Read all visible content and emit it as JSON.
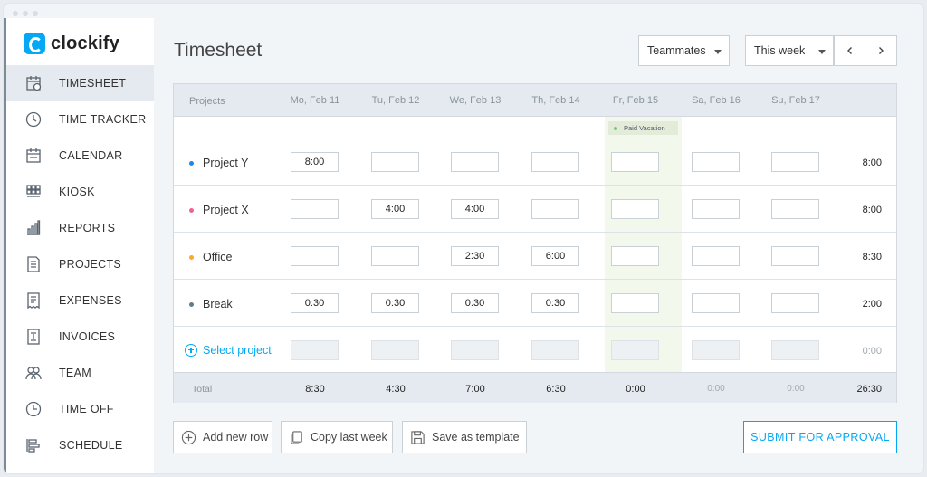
{
  "app": {
    "name": "clockify"
  },
  "sidebar": {
    "items": [
      {
        "label": "TIMESHEET",
        "icon": "timesheet-icon",
        "active": true
      },
      {
        "label": "TIME TRACKER",
        "icon": "clock-icon"
      },
      {
        "label": "CALENDAR",
        "icon": "calendar-icon"
      },
      {
        "label": "KIOSK",
        "icon": "kiosk-icon"
      },
      {
        "label": "REPORTS",
        "icon": "bar-chart-icon"
      },
      {
        "label": "PROJECTS",
        "icon": "document-icon"
      },
      {
        "label": "EXPENSES",
        "icon": "receipt-icon"
      },
      {
        "label": "INVOICES",
        "icon": "invoice-icon"
      },
      {
        "label": "TEAM",
        "icon": "team-icon"
      },
      {
        "label": "TIME OFF",
        "icon": "time-off-icon"
      },
      {
        "label": "SCHEDULE",
        "icon": "schedule-icon"
      }
    ]
  },
  "header": {
    "title": "Timesheet",
    "teammates_label": "Teammates",
    "range_label": "This week",
    "prev_icon": "chevron-left-icon",
    "next_icon": "chevron-right-icon"
  },
  "table": {
    "projects_header": "Projects",
    "days": [
      "Mo, Feb 11",
      "Tu, Feb 12",
      "We, Feb 13",
      "Th, Feb 14",
      "Fr, Feb 15",
      "Sa, Feb 16",
      "Su, Feb 17"
    ],
    "vacation_badge": "Paid Vacation",
    "rows": [
      {
        "name": "Project Y",
        "color": "#1e88e5",
        "values": [
          "8:00",
          "",
          "",
          "",
          "",
          "",
          ""
        ],
        "total": "8:00"
      },
      {
        "name": "Project X",
        "color": "#f06292",
        "values": [
          "",
          "4:00",
          "4:00",
          "",
          "",
          "",
          ""
        ],
        "total": "8:00"
      },
      {
        "name": "Office",
        "color": "#ffa726",
        "values": [
          "",
          "",
          "2:30",
          "6:00",
          "",
          "",
          ""
        ],
        "total": "8:30"
      },
      {
        "name": "Break",
        "color": "#607d8b",
        "values": [
          "0:30",
          "0:30",
          "0:30",
          "0:30",
          "",
          "",
          ""
        ],
        "total": "2:00"
      }
    ],
    "select_project_label": "Select project",
    "select_project_total": "0:00",
    "total_label": "Total",
    "day_totals": [
      "8:30",
      "4:30",
      "7:00",
      "6:30",
      "0:00",
      "0:00",
      "0:00"
    ],
    "grand_total": "26:30"
  },
  "actions": {
    "add_row": "Add new row",
    "copy_week": "Copy last week",
    "save_template": "Save as template",
    "submit": "SUBMIT FOR APPROVAL"
  },
  "colors": {
    "accent": "#03a9f4",
    "vacation_column": "#f3f8ec"
  }
}
